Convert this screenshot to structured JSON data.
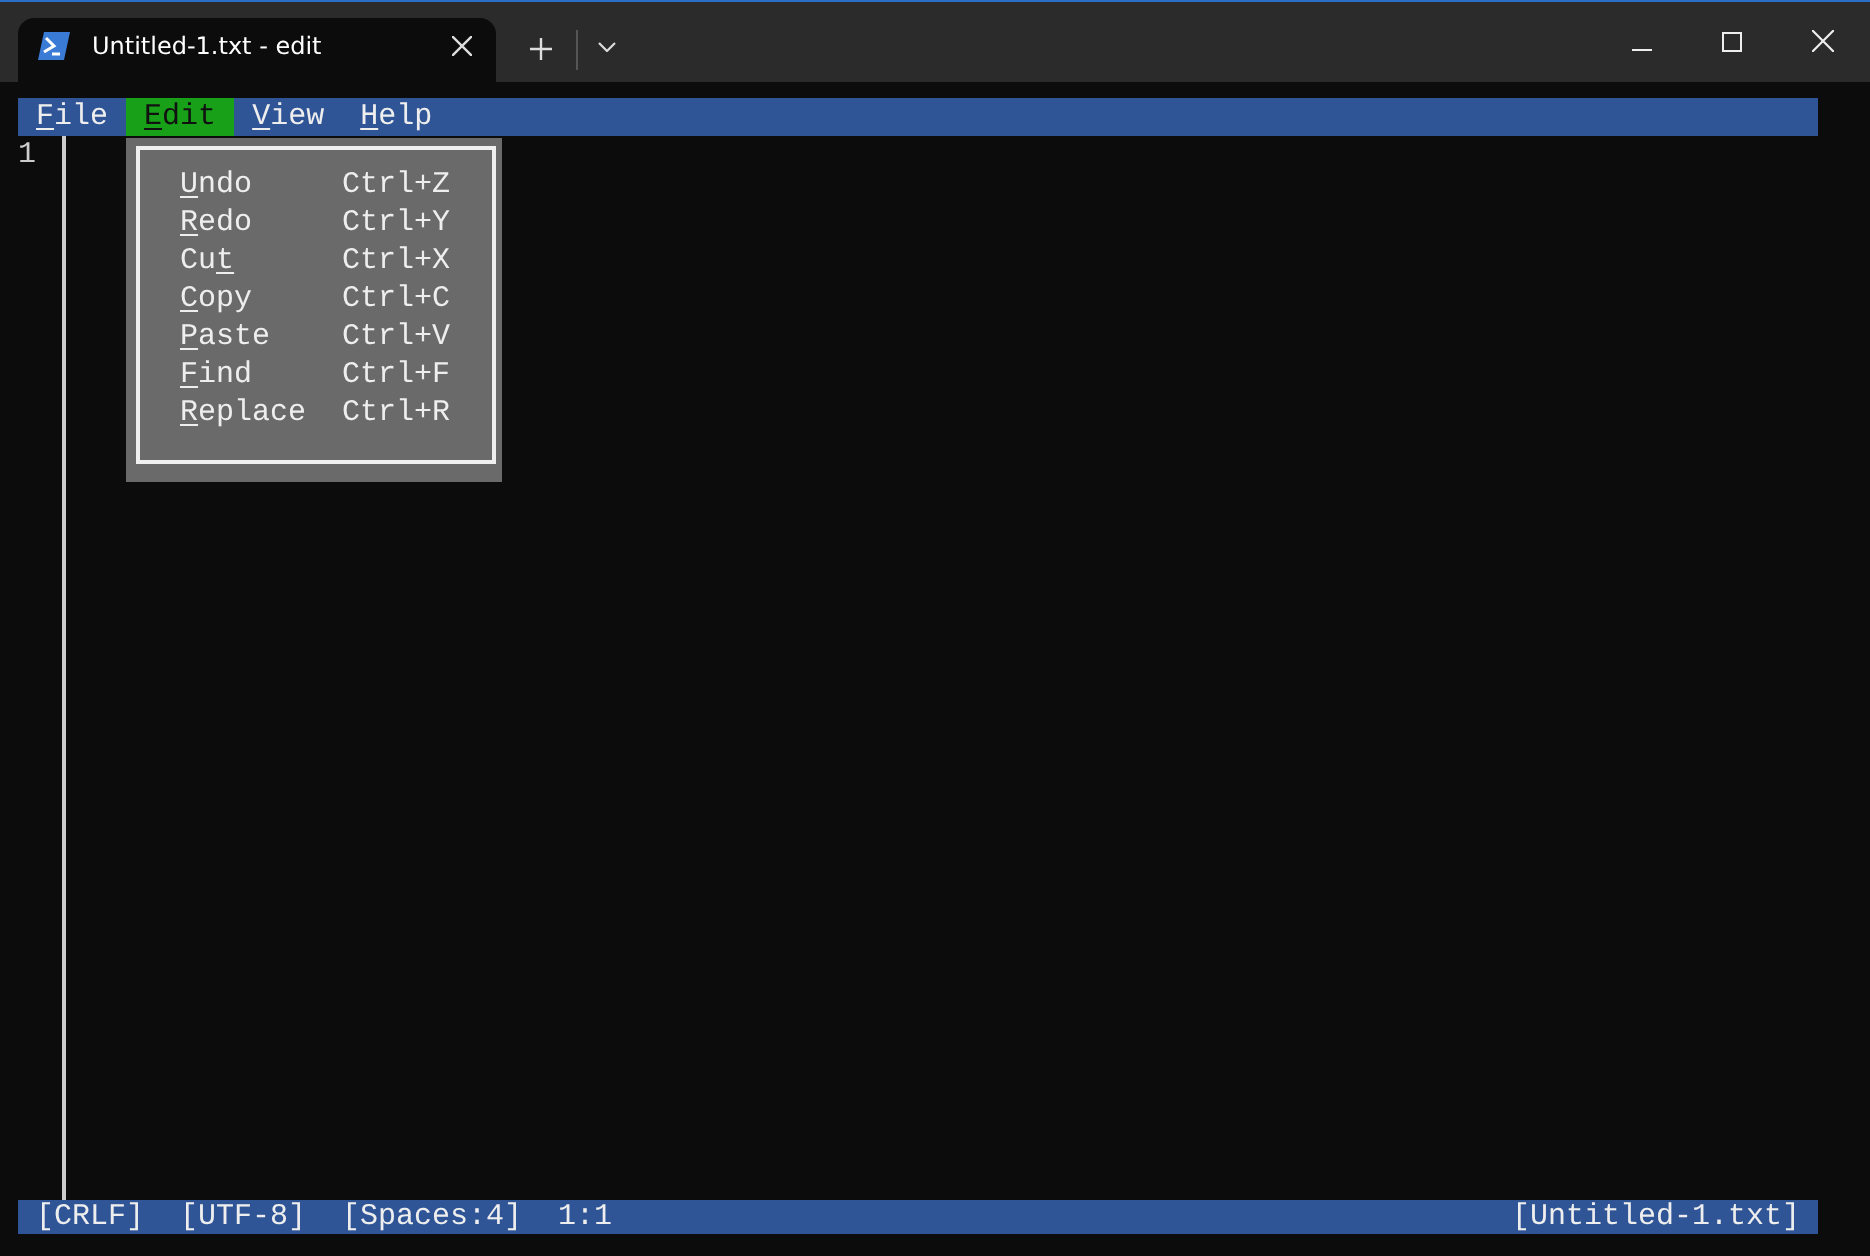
{
  "window": {
    "tab_title": "Untitled-1.txt - edit"
  },
  "menu_bar": [
    {
      "label": "File",
      "hotkey_last_letter": false,
      "selected": false
    },
    {
      "label": "Edit",
      "hotkey_last_letter": false,
      "selected": true
    },
    {
      "label": "View",
      "hotkey_last_letter": false,
      "selected": false
    },
    {
      "label": "Help",
      "hotkey_last_letter": false,
      "selected": false
    }
  ],
  "editor": {
    "line_numbers": [
      "1"
    ]
  },
  "edit_menu": [
    {
      "label": "Undo",
      "hotkey_last_letter": false,
      "shortcut": "Ctrl+Z"
    },
    {
      "label": "Redo",
      "hotkey_last_letter": false,
      "shortcut": "Ctrl+Y"
    },
    {
      "label": "Cut",
      "hotkey_last_letter": true,
      "shortcut": "Ctrl+X"
    },
    {
      "label": "Copy",
      "hotkey_last_letter": false,
      "shortcut": "Ctrl+C"
    },
    {
      "label": "Paste",
      "hotkey_last_letter": false,
      "shortcut": "Ctrl+V"
    },
    {
      "label": "Find",
      "hotkey_last_letter": false,
      "shortcut": "Ctrl+F"
    },
    {
      "label": "Replace",
      "hotkey_last_letter": false,
      "shortcut": "Ctrl+R"
    }
  ],
  "status_bar": {
    "left": [
      "[CRLF]",
      "[UTF-8]",
      "[Spaces:4]",
      "1:1"
    ],
    "right": "[Untitled-1.txt]"
  }
}
